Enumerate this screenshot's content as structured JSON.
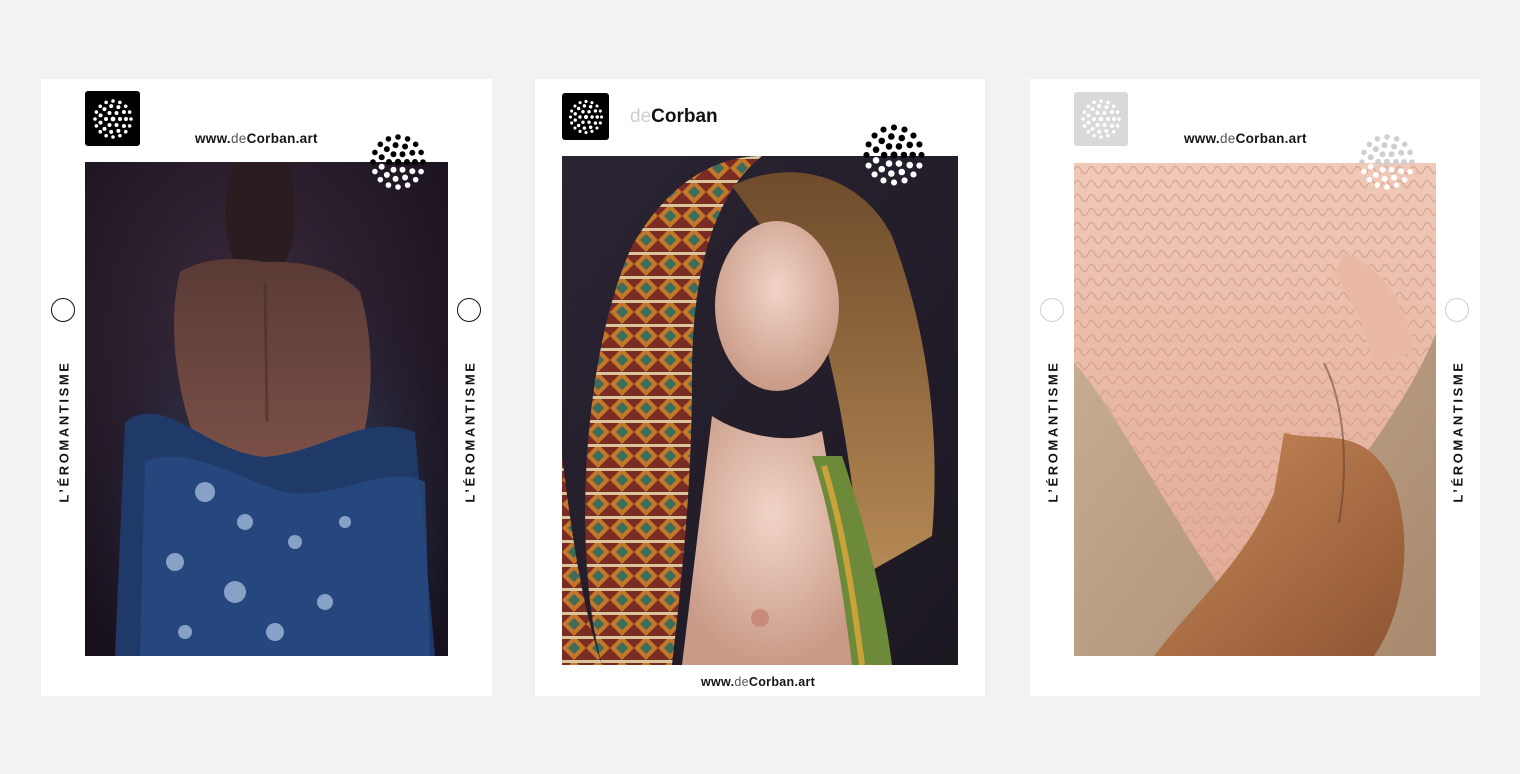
{
  "cards": [
    {
      "url_prefix": "www.",
      "url_light": "de",
      "url_main": "Corban.art",
      "side_label_left": "L’ÉROMANTISME",
      "side_label_right": "L’ÉROMANTISME",
      "logo_color": "#000000",
      "dots_color": "#000000"
    },
    {
      "brand_light": "de",
      "brand_main": "Corban",
      "url_prefix": "www.",
      "url_light": "de",
      "url_main": "Corban.art",
      "logo_color": "#000000",
      "dots_color": "#000000"
    },
    {
      "url_prefix": "www.",
      "url_light": "de",
      "url_main": "Corban.art",
      "side_label_left": "L’ÉROMANTISME",
      "side_label_right": "L’ÉROMANTISME",
      "logo_color": "#d9d9d9",
      "dots_color": "#cfcfcf"
    }
  ]
}
